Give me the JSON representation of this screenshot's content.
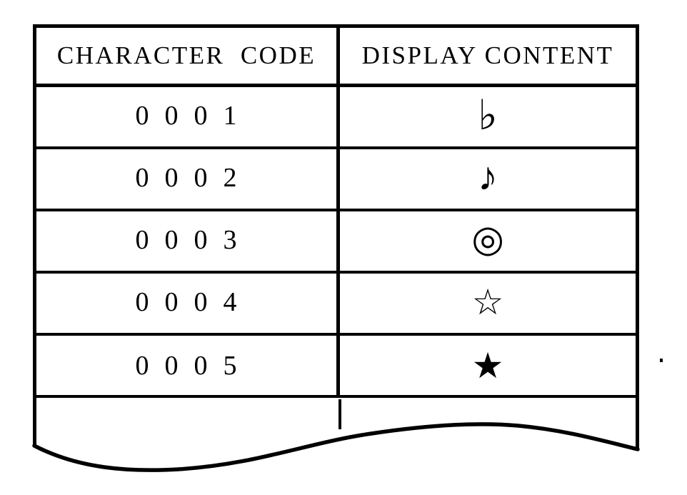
{
  "figure": {
    "kind": "patent-drawing-table",
    "description": "Character code to display content mapping table with torn bottom edge"
  },
  "table": {
    "headers": [
      {
        "key": "character_code",
        "label": "CHARACTER  CODE"
      },
      {
        "key": "display_content",
        "label": "DISPLAY CONTENT"
      }
    ],
    "rows": [
      {
        "code": "0  0  0  1",
        "symbol": "♭",
        "symbol_name": "music-flat-sign"
      },
      {
        "code": "0  0  0  2",
        "symbol": "♪",
        "symbol_name": "eighth-note"
      },
      {
        "code": "0  0  0  3",
        "symbol": "◎",
        "symbol_name": "bullseye-double-circle"
      },
      {
        "code": "0  0  0  4",
        "symbol": "☆",
        "symbol_name": "white-star"
      },
      {
        "code": "0  0  0  5",
        "symbol": "★",
        "symbol_name": "black-star"
      }
    ],
    "partial_row": {
      "code": "",
      "symbol": ""
    }
  },
  "colors": {
    "ink": "#000000",
    "paper": "#ffffff"
  }
}
